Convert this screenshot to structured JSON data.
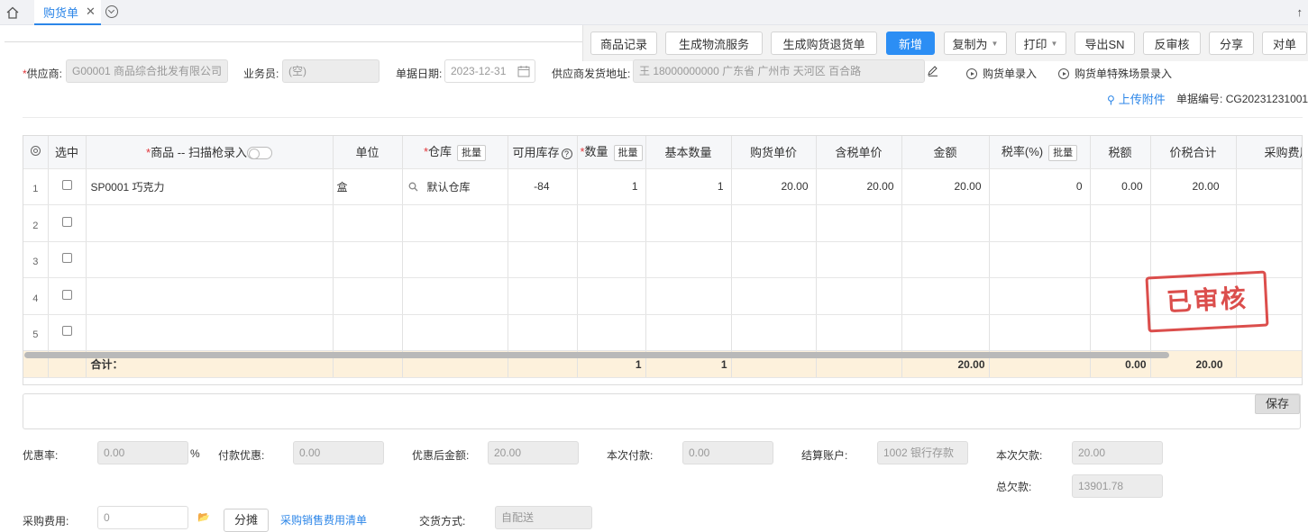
{
  "tabs": {
    "active_label": "购货单",
    "close_glyph": "✕",
    "scroll_up_glyph": "↑"
  },
  "toolbar": {
    "goods_record": "商品记录",
    "gen_logistics": "生成物流服务",
    "gen_return": "生成购货退货单",
    "add_new": "新增",
    "copy_as": "复制为",
    "print": "打印",
    "export_sn": "导出SN",
    "reverse_audit": "反审核",
    "share": "分享",
    "reconcile": "对单"
  },
  "header": {
    "supplier_label": "供应商:",
    "supplier_value": "G00001 商品综合批发有限公司",
    "salesman_label": "业务员:",
    "salesman_value": "(空)",
    "date_label": "单据日期:",
    "date_value": "2023-12-31",
    "address_label": "供应商发货地址:",
    "address_value": "王 18000000000 广东省 广州市 天河区 百合路",
    "entry_link": "购货单录入",
    "special_entry_link": "购货单特殊场景录入",
    "upload_link": "上传附件",
    "doc_no_label": "单据编号:",
    "doc_no_value": "CG20231231001"
  },
  "table": {
    "columns": {
      "select": "选中",
      "product": "商品 -- 扫描枪录入",
      "unit": "单位",
      "warehouse": "仓库",
      "stock": "可用库存",
      "qty": "数量",
      "base_qty": "基本数量",
      "price": "购货单价",
      "tax_price": "含税单价",
      "amount": "金额",
      "tax_rate": "税率(%)",
      "tax": "税额",
      "total": "价税合计",
      "purchase_fee": "采购费用",
      "batch": "批量"
    },
    "rows": [
      {
        "no": "1",
        "product": "SP0001 巧克力",
        "unit": "盒",
        "warehouse": "默认仓库",
        "stock": "-84",
        "qty": "1",
        "base_qty": "1",
        "price": "20.00",
        "tax_price": "20.00",
        "amount": "20.00",
        "tax_rate": "0",
        "tax": "0.00",
        "total": "20.00",
        "fee": ""
      },
      {
        "no": "2"
      },
      {
        "no": "3"
      },
      {
        "no": "4"
      },
      {
        "no": "5"
      }
    ],
    "totals": {
      "label": "合计：",
      "qty": "1",
      "base_qty": "1",
      "amount": "20.00",
      "tax": "0.00",
      "total": "20.00"
    },
    "stamp": "已审核"
  },
  "memo": {
    "save": "保存"
  },
  "footer": {
    "discount_rate_label": "优惠率:",
    "discount_rate_value": "0.00",
    "percent": "%",
    "payment_discount_label": "付款优惠:",
    "payment_discount_value": "0.00",
    "after_discount_label": "优惠后金额:",
    "after_discount_value": "20.00",
    "this_payment_label": "本次付款:",
    "this_payment_value": "0.00",
    "settle_account_label": "结算账户:",
    "settle_account_value": "1002 银行存款",
    "this_debt_label": "本次欠款:",
    "this_debt_value": "20.00",
    "total_debt_label": "总欠款:",
    "total_debt_value": "13901.78",
    "purchase_fee_label": "采购费用:",
    "purchase_fee_value": "0",
    "allocate_button": "分摊",
    "fee_list_link": "采购销售费用清单",
    "delivery_label": "交货方式:",
    "delivery_value": "自配送"
  },
  "colors": {
    "accent": "#2c86e8",
    "primary_button": "#2c8ef4",
    "stamp": "#d93f3d",
    "total_row": "#fdf1dc",
    "required": "#e0363a"
  }
}
